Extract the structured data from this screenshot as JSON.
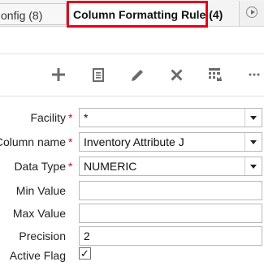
{
  "tabs": {
    "previous_label": "onfig (8)",
    "active_label": "Column Formatting Rule (4)"
  },
  "form": {
    "facility": {
      "label": "Facility",
      "value": "*"
    },
    "column_name": {
      "label": "Column name",
      "value": "Inventory Attribute J"
    },
    "data_type": {
      "label": "Data Type",
      "value": "NUMERIC"
    },
    "min_value": {
      "label": "Min Value",
      "value": ""
    },
    "max_value": {
      "label": "Max Value",
      "value": ""
    },
    "precision": {
      "label": "Precision",
      "value": "2"
    },
    "active_flag": {
      "label": "Active Flag",
      "checked": true,
      "mark": "✓"
    },
    "required_mark": "*"
  },
  "toolbar": {
    "icons": [
      "add-icon",
      "document-icon",
      "edit-icon",
      "delete-icon",
      "grid-config-icon",
      "more-icon"
    ]
  },
  "colors": {
    "active_tab_border": "#e3001b",
    "required": "#c8102e",
    "icon": "#6b6b6b"
  }
}
